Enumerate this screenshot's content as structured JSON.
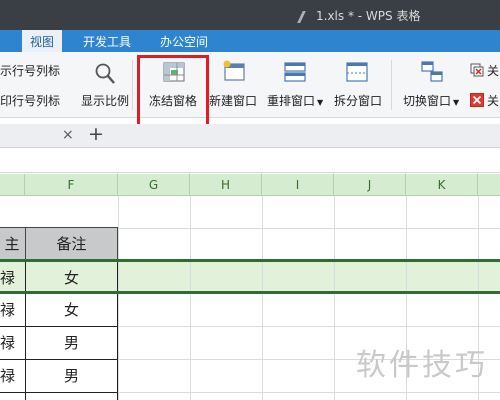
{
  "window": {
    "title": "1.xls * - WPS 表格"
  },
  "menu": {
    "tabs": [
      "视图",
      "开发工具",
      "办公空间"
    ],
    "active": "视图"
  },
  "ribbon": {
    "show_row_col_headers": "示行号列标",
    "print_row_col_headers": "印行号列标",
    "zoom": "显示比例",
    "freeze_panes": "冻结窗格",
    "new_window": "新建窗口",
    "arrange": "重排窗口",
    "split": "拆分窗口",
    "switch": "切换窗口",
    "close_top": "关",
    "close_bottom": "关"
  },
  "tabs_row": {
    "close": "×",
    "add": "+"
  },
  "sheet": {
    "columns": [
      "F",
      "G",
      "H",
      "I",
      "J",
      "K"
    ],
    "header_cell": "备注",
    "header_cell_left": "主",
    "rows": [
      {
        "left": "禄",
        "value": "女"
      },
      {
        "left": "禄",
        "value": "女"
      },
      {
        "left": "禄",
        "value": "男"
      },
      {
        "left": "禄",
        "value": "男"
      }
    ]
  },
  "watermark": "软件技巧"
}
